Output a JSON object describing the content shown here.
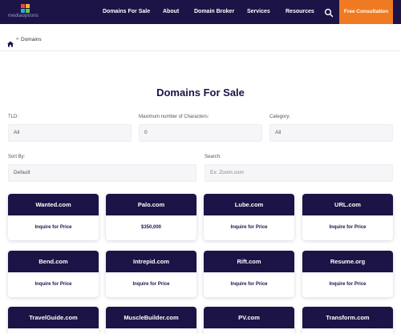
{
  "nav": {
    "logo_text": "mediaoptions",
    "links": [
      "Domains For Sale",
      "About",
      "Domain Broker",
      "Services",
      "Resources"
    ],
    "cta": "Free Consultation"
  },
  "breadcrumb": {
    "sep": "»",
    "current": "Domains"
  },
  "page_title": "Domains For Sale",
  "filters": {
    "tld": {
      "label": "TLD:",
      "value": "All"
    },
    "max_chars": {
      "label": "Maximum number of Characters:",
      "value": "0"
    },
    "category": {
      "label": "Category:",
      "value": "All"
    },
    "sort": {
      "label": "Sort By:",
      "value": "Default"
    },
    "search": {
      "label": "Search:",
      "placeholder": "Ex: Zoom.com"
    }
  },
  "domains": [
    {
      "name": "Wanted.com",
      "price": "Inquire for Price"
    },
    {
      "name": "Palo.com",
      "price": "$350,000"
    },
    {
      "name": "Lube.com",
      "price": "Inquire for Price"
    },
    {
      "name": "URL.com",
      "price": "Inquire for Price"
    },
    {
      "name": "Bend.com",
      "price": "Inquire for Price"
    },
    {
      "name": "Intrepid.com",
      "price": "Inquire for Price"
    },
    {
      "name": "Rift.com",
      "price": "Inquire for Price"
    },
    {
      "name": "Resume.org",
      "price": "Inquire for Price"
    },
    {
      "name": "TravelGuide.com",
      "price": ""
    },
    {
      "name": "MuscleBuilder.com",
      "price": ""
    },
    {
      "name": "PV.com",
      "price": ""
    },
    {
      "name": "Transform.com",
      "price": ""
    }
  ],
  "colors": {
    "navy": "#1c1346",
    "orange": "#f07a22"
  },
  "icons": {
    "search": "search-icon",
    "home": "home-icon"
  }
}
